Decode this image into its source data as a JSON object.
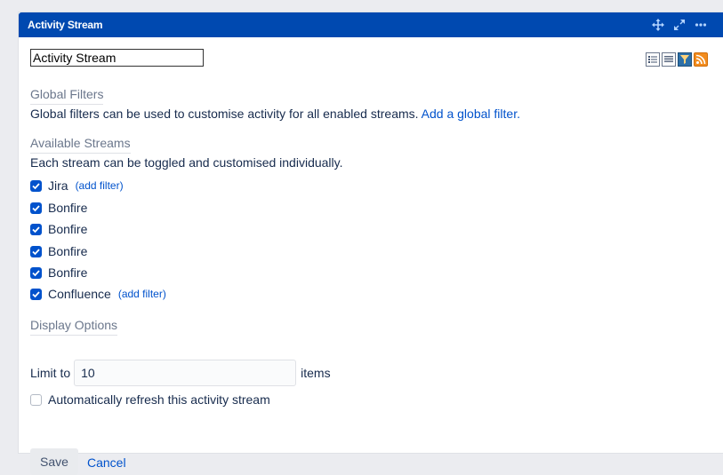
{
  "header": {
    "title": "Activity Stream",
    "tools": [
      "move-icon",
      "expand-icon",
      "more-icon"
    ]
  },
  "form": {
    "name_value": "Activity Stream",
    "view_icons": [
      "list-view-icon",
      "detail-view-icon",
      "filter-view-icon",
      "rss-feed-icon"
    ]
  },
  "global_filters": {
    "title": "Global Filters",
    "description": "Global filters can be used to customise activity for all enabled streams.",
    "link": "Add a global filter."
  },
  "available_streams": {
    "title": "Available Streams",
    "description": "Each stream can be toggled and customised individually.",
    "items": [
      {
        "label": "Jira",
        "checked": true,
        "filter_link": "(add filter)"
      },
      {
        "label": "Bonfire",
        "checked": true
      },
      {
        "label": "Bonfire",
        "checked": true
      },
      {
        "label": "Bonfire",
        "checked": true
      },
      {
        "label": "Bonfire",
        "checked": true
      },
      {
        "label": "Confluence",
        "checked": true,
        "filter_link": "(add filter)"
      }
    ]
  },
  "display_options": {
    "title": "Display Options",
    "limit_label": "Limit to",
    "limit_value": "10",
    "items_label": "items",
    "auto_refresh_label": "Automatically refresh this activity stream",
    "auto_refresh_checked": false
  },
  "actions": {
    "save": "Save",
    "cancel": "Cancel"
  },
  "colors": {
    "header_bg": "#0049b0",
    "link": "#0052cc",
    "checkbox": "#0052cc",
    "rss": "#f28c1e"
  }
}
